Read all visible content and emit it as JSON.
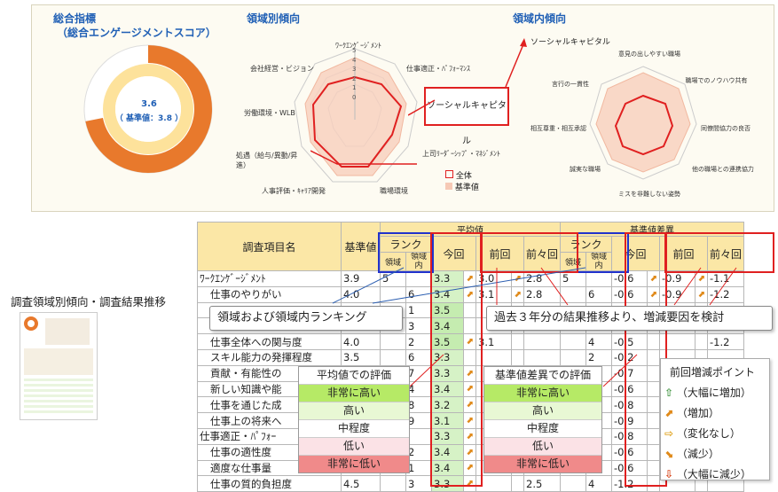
{
  "top": {
    "overall_title": "総合指標",
    "overall_subtitle": "（総合エンゲージメントスコア）",
    "donut_value": "3.6",
    "donut_baseline": "（ 基準値：3.8 ）",
    "domain_title": "領域別傾向",
    "within_title": "領域内傾向",
    "callout_social": "ソーシャルキャピタル",
    "radar1_axes": [
      "ﾜｰｸｴﾝｹﾞｰｼﾞﾒﾝﾄ",
      "仕事適正・ﾊﾟﾌｫｰﾏﾝｽ",
      "ソーシャルキャピタル",
      "上司ﾘｰﾀﾞｰｼｯﾌﾟ・ﾏﾈｼﾞﾒﾝﾄ",
      "職場環境",
      "人事評価・ｷｬﾘｱ開発",
      "処遇（給与/異動/昇進）",
      "労働環境・WLB",
      "会社経営・ビジョン"
    ],
    "radar1_ticks": [
      "5",
      "4",
      "3",
      "2",
      "1",
      "0"
    ],
    "radar1_legend": [
      "全体",
      "基準値"
    ],
    "radar2_title": "ソーシャルキャピタル",
    "radar2_axes": [
      "意見の出しやすい職場",
      "職場でのノウハウ共有",
      "同僚間協力の良否",
      "他の職場との連携協力",
      "ミスを非難しない姿勢",
      "誠実な職場",
      "相互尊重・相互承認",
      "言行の一貫性"
    ]
  },
  "left_caption": "調査領域別傾向・調査結果推移",
  "table": {
    "h_item": "調査項目名",
    "h_base": "基準値",
    "h_avg": "平均値",
    "h_diff": "基準値差異",
    "h_rank": "ランク",
    "h_rank_domain": "領域",
    "h_rank_within": "領域内",
    "h_now": "今回",
    "h_prev": "前回",
    "h_prev2": "前々回",
    "rows": [
      {
        "name": "ﾜｰｸｴﾝｹﾞｰｼﾞﾒﾝﾄ",
        "base": "3.9",
        "r1": "5",
        "r2": "",
        "now": "3.3",
        "prev": "3.0",
        "prev2": "2.8",
        "d1": "5",
        "d2": "",
        "dnow": "-0.6",
        "dprev": "-0.9",
        "dprev2": "-1.1",
        "a": true,
        "a2": true,
        "da": true,
        "da2": true
      },
      {
        "name": "仕事のやりがい",
        "base": "4.0",
        "r1": "",
        "r2": "6",
        "now": "3.4",
        "prev": "3.1",
        "prev2": "2.8",
        "d1": "",
        "d2": "6",
        "dnow": "-0.6",
        "dprev": "-0.9",
        "dprev2": "-1.2",
        "a": true,
        "a2": true,
        "da": true,
        "da2": true
      },
      {
        "name": "",
        "base": "",
        "r1": "",
        "r2": "1",
        "now": "3.5",
        "prev": "",
        "prev2": "",
        "d1": "",
        "d2": "",
        "dnow": "",
        "dprev": "",
        "dprev2": ""
      },
      {
        "name": "",
        "base": "",
        "r1": "",
        "r2": "3",
        "now": "3.4",
        "prev": "",
        "prev2": "",
        "d1": "",
        "d2": "",
        "dnow": "",
        "dprev": "",
        "dprev2": ""
      },
      {
        "name": "仕事全体への関与度",
        "base": "4.0",
        "r1": "",
        "r2": "2",
        "now": "3.5",
        "prev": "3.1",
        "prev2": "",
        "d1": "",
        "d2": "4",
        "dnow": "-0.5",
        "dprev": "",
        "dprev2": "-1.2",
        "a": true
      },
      {
        "name": "スキル能力の発揮程度",
        "base": "3.5",
        "r1": "",
        "r2": "6",
        "now": "3.3",
        "prev": "",
        "prev2": "",
        "d1": "",
        "d2": "2",
        "dnow": "-0.2",
        "dprev": "",
        "dprev2": ""
      },
      {
        "name": "貢献・有能性の",
        "base": "",
        "r1": "",
        "r2": "7",
        "now": "3.3",
        "prev": "",
        "prev2": "",
        "d1": "",
        "d2": "7",
        "dnow": "-0.7",
        "dprev": "",
        "dprev2": "",
        "a": true
      },
      {
        "name": "新しい知識や能",
        "base": "",
        "r1": "",
        "r2": "4",
        "now": "3.4",
        "prev": "",
        "prev2": "",
        "d1": "",
        "d2": "5",
        "dnow": "-0.6",
        "dprev": "",
        "dprev2": "",
        "a": true
      },
      {
        "name": "仕事を通じた成",
        "base": "",
        "r1": "",
        "r2": "8",
        "now": "3.2",
        "prev": "",
        "prev2": "",
        "d1": "",
        "d2": "8",
        "dnow": "-0.8",
        "dprev": "",
        "dprev2": "",
        "a": true
      },
      {
        "name": "仕事上の将来へ",
        "base": "",
        "r1": "",
        "r2": "9",
        "now": "3.1",
        "prev": "",
        "prev2": "",
        "d1": "",
        "d2": "9",
        "dnow": "-0.9",
        "dprev": "",
        "dprev2": "",
        "a": true
      },
      {
        "name": "仕事適正・ﾊﾟﾌｫｰ",
        "base": "",
        "r1": "",
        "r2": "",
        "now": "3.3",
        "prev": "",
        "prev2": "",
        "d1": "",
        "d2": "",
        "dnow": "-0.8",
        "dprev": "",
        "dprev2": "",
        "a": true
      },
      {
        "name": "仕事の適性度",
        "base": "",
        "r1": "",
        "r2": "2",
        "now": "3.4",
        "prev": "",
        "prev2": "",
        "d1": "",
        "d2": "2",
        "dnow": "-0.6",
        "dprev": "",
        "dprev2": "",
        "a": true
      },
      {
        "name": "適度な仕事量",
        "base": "",
        "r1": "",
        "r2": "1",
        "now": "3.4",
        "prev": "",
        "prev2": "",
        "d1": "",
        "d2": "1",
        "dnow": "-0.6",
        "dprev": "",
        "dprev2": "",
        "a": true
      },
      {
        "name": "仕事の質的負担度",
        "base": "4.5",
        "r1": "",
        "r2": "3",
        "now": "3.3",
        "prev": "",
        "prev2": "2.5",
        "d1": "",
        "d2": "4",
        "dnow": "-1.2",
        "dprev": "",
        "dprev2": "",
        "a": true
      }
    ]
  },
  "callouts": {
    "ranking": "領域および領域内ランキング",
    "trend": "過去３年分の結果推移より、増減要因を検討"
  },
  "eval_avg": {
    "title": "平均値での評価",
    "items": [
      "非常に高い",
      "高い",
      "中程度",
      "低い",
      "非常に低い"
    ]
  },
  "eval_diff": {
    "title": "基準値差異での評価",
    "items": [
      "非常に高い",
      "高い",
      "中程度",
      "低い",
      "非常に低い"
    ]
  },
  "change_legend": {
    "title": "前回増減ポイント",
    "items": [
      "（大幅に増加）",
      "（増加）",
      "（変化なし）",
      "（減少）",
      "（大幅に減少）"
    ]
  },
  "colors": {
    "accent": "#e8792c",
    "blue": "#1f5fb5",
    "red_border": "#e02020",
    "header_fill": "#fbe7a6",
    "green": "#d6f2c6"
  }
}
